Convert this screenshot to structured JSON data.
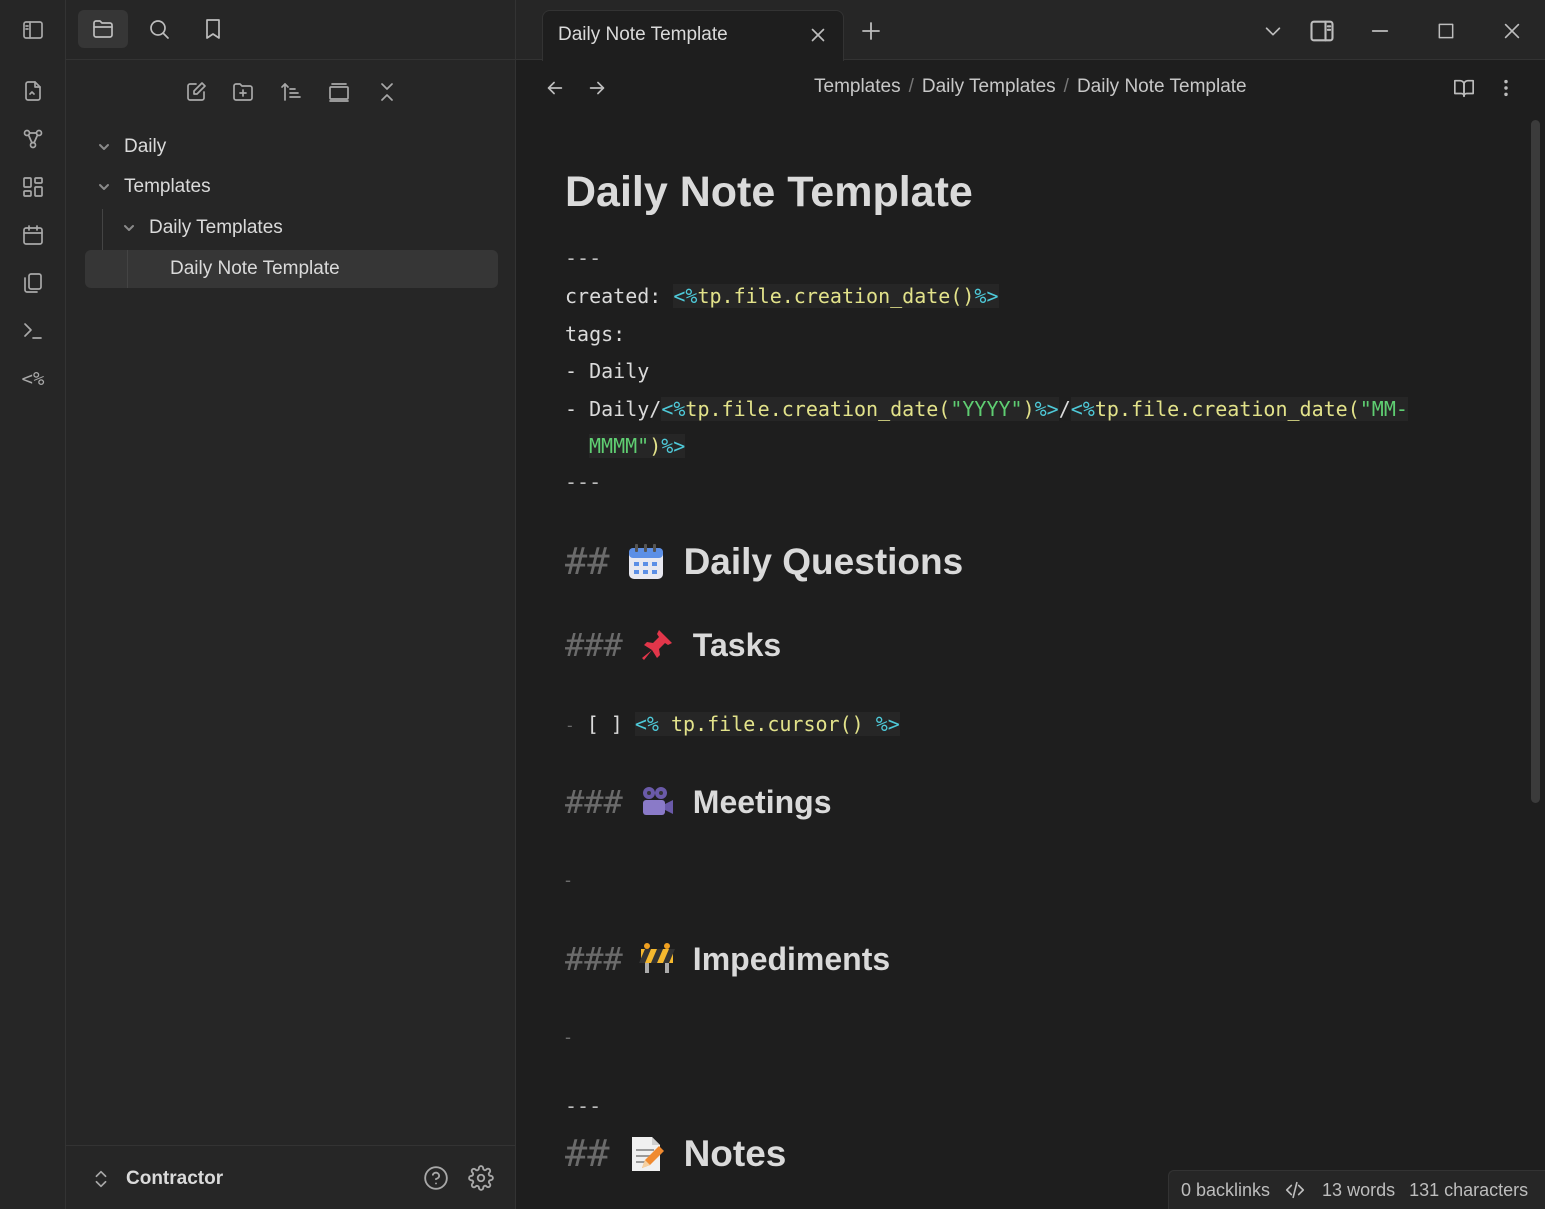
{
  "ribbon": {
    "items": [
      {
        "icon": "open-quick-switcher-icon"
      },
      {
        "icon": "graph-view-icon"
      },
      {
        "icon": "canvas-icon"
      },
      {
        "icon": "daily-note-calendar-icon"
      },
      {
        "icon": "insert-template-icon"
      },
      {
        "icon": "command-palette-icon"
      },
      {
        "icon": "templater-icon",
        "label": "<%"
      }
    ]
  },
  "sidebar": {
    "tabs": [
      "files",
      "search",
      "bookmarks"
    ],
    "tree": [
      {
        "label": "Daily",
        "expanded": true
      },
      {
        "label": "Templates",
        "expanded": true
      },
      {
        "label": "Daily Templates",
        "expanded": true
      },
      {
        "label": "Daily Note Template",
        "selected": true
      }
    ],
    "vault_name": "Contractor"
  },
  "tab": {
    "title": "Daily Note Template"
  },
  "breadcrumbs": [
    "Templates",
    "Daily Templates",
    "Daily Note Template"
  ],
  "note": {
    "title": "Daily Note Template",
    "frontmatter": {
      "open": "---",
      "created_key": "created:",
      "created_value_open": "<%",
      "created_value_fn": "tp.file.creation_date()",
      "created_value_close": "%>",
      "tags_key": "tags:",
      "tag1_prefix": "- Daily",
      "tag2_prefix": "- Daily/",
      "tag2_open1": "<%",
      "tag2_fn1": "tp.file.creation_date(",
      "tag2_arg1": "\"YYYY\"",
      "tag2_close1": ")%>",
      "tag2_slash": "/",
      "tag2_open2": "<%",
      "tag2_fn2": "tp.file.creation_date(",
      "tag2_arg2a": "\"MM-",
      "tag2_arg2b": "MMMM\"",
      "tag2_close2": ")%>",
      "close": "---"
    },
    "sections": {
      "daily_questions": {
        "hash": "##",
        "emoji": "calendar",
        "text": "Daily Questions"
      },
      "tasks": {
        "hash": "###",
        "emoji": "pushpin",
        "text": "Tasks"
      },
      "task_item": {
        "dash": "-",
        "checkbox": "[ ]",
        "open": "<%",
        "fn": "tp.file.cursor()",
        "close": "%>"
      },
      "meetings": {
        "hash": "###",
        "emoji": "movie-camera",
        "text": "Meetings"
      },
      "meetings_item": "-",
      "impediments": {
        "hash": "###",
        "emoji": "construction",
        "text": "Impediments"
      },
      "impediments_item": "-",
      "rule": "---",
      "notes": {
        "hash": "##",
        "emoji": "memo",
        "text": "Notes"
      }
    }
  },
  "status_bar": {
    "backlinks": "0 backlinks",
    "words": "13 words",
    "characters": "131 characters"
  },
  "colors": {
    "background": "#1e1e1e",
    "panel": "#262626",
    "accent_cyan": "#4ec9d8",
    "code_yellow": "#e2e28a",
    "string_green": "#5fce72"
  }
}
